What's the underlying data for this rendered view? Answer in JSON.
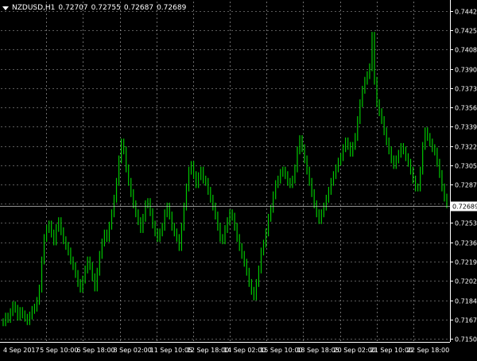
{
  "symbol": "NZDUSD,H1",
  "ohlc": {
    "open": "0.72707",
    "high": "0.72755",
    "low": "0.72687",
    "close": "0.72689"
  },
  "colors": {
    "background": "#000000",
    "grid": "#b4b4b4",
    "bars": "#00c800",
    "axis_text": "#ffffff",
    "bid_label_bg": "#ffffff",
    "bid_label_text": "#000000",
    "bid_line": "#c0c0c0"
  },
  "chart_data": {
    "type": "line",
    "ylim": [
      0.71475,
      0.74505
    ],
    "y_ticks": [
      "0.74420",
      "0.74250",
      "0.74080",
      "0.73905",
      "0.73735",
      "0.73565",
      "0.73390",
      "0.73220",
      "0.73050",
      "0.72875",
      "0.72705",
      "0.72535",
      "0.72360",
      "0.72190",
      "0.72020",
      "0.71845",
      "0.71675",
      "0.71505"
    ],
    "x_ticks": [
      "4 Sep 2017",
      "5 Sep 10:00",
      "6 Sep 18:00",
      "8 Sep 02:00",
      "11 Sep 10:05",
      "12 Sep 18:00",
      "14 Sep 02:00",
      "15 Sep 10:00",
      "18 Sep 18:05",
      "20 Sep 02:00",
      "21 Sep 10:00",
      "22 Sep 18:00"
    ],
    "current_price": "0.72689",
    "grid": true,
    "series": [
      {
        "values": [
          0.7165,
          0.717,
          0.7168,
          0.7174,
          0.718,
          0.7177,
          0.717,
          0.7175,
          0.7172,
          0.7169,
          0.7166,
          0.7171,
          0.7176,
          0.7178,
          0.7184,
          0.7195,
          0.722,
          0.724,
          0.7248,
          0.7252,
          0.7244,
          0.7237,
          0.7249,
          0.7255,
          0.7246,
          0.7238,
          0.7233,
          0.7228,
          0.722,
          0.7215,
          0.7208,
          0.72,
          0.7195,
          0.7203,
          0.7212,
          0.722,
          0.7215,
          0.7205,
          0.7196,
          0.721,
          0.7225,
          0.7236,
          0.7244,
          0.724,
          0.7251,
          0.7262,
          0.7275,
          0.729,
          0.731,
          0.7325,
          0.7318,
          0.7302,
          0.729,
          0.728,
          0.727,
          0.7262,
          0.7255,
          0.7248,
          0.7258,
          0.727,
          0.7272,
          0.7263,
          0.7252,
          0.7245,
          0.724,
          0.7245,
          0.725,
          0.7262,
          0.7268,
          0.726,
          0.725,
          0.7245,
          0.724,
          0.7232,
          0.725,
          0.7268,
          0.7285,
          0.73,
          0.7305,
          0.7296,
          0.7288,
          0.7295,
          0.73,
          0.7292,
          0.729,
          0.7282,
          0.7275,
          0.7268,
          0.726,
          0.725,
          0.724,
          0.7238,
          0.7248,
          0.7255,
          0.7262,
          0.7259,
          0.725,
          0.724,
          0.7232,
          0.7225,
          0.7218,
          0.721,
          0.72,
          0.7193,
          0.7188,
          0.72,
          0.7212,
          0.7228,
          0.7235,
          0.7245,
          0.7258,
          0.7266,
          0.7278,
          0.7288,
          0.7292,
          0.7298,
          0.73,
          0.7296,
          0.729,
          0.7288,
          0.7292,
          0.7302,
          0.7318,
          0.7328,
          0.732,
          0.731,
          0.73,
          0.729,
          0.728,
          0.727,
          0.7262,
          0.7256,
          0.7262,
          0.7268,
          0.7275,
          0.7282,
          0.729,
          0.7296,
          0.7302,
          0.7308,
          0.7312,
          0.732,
          0.7326,
          0.7322,
          0.7316,
          0.7322,
          0.733,
          0.7345,
          0.736,
          0.7372,
          0.738,
          0.7385,
          0.7392,
          0.742,
          0.738,
          0.736,
          0.7352,
          0.7345,
          0.7335,
          0.7326,
          0.7318,
          0.731,
          0.7305,
          0.731,
          0.7315,
          0.7321,
          0.7318,
          0.7312,
          0.7307,
          0.73,
          0.7292,
          0.7285,
          0.7285,
          0.73,
          0.7322,
          0.7335,
          0.733,
          0.7325,
          0.732,
          0.7317,
          0.7307,
          0.7297,
          0.7285,
          0.7276,
          0.727
        ]
      }
    ]
  }
}
